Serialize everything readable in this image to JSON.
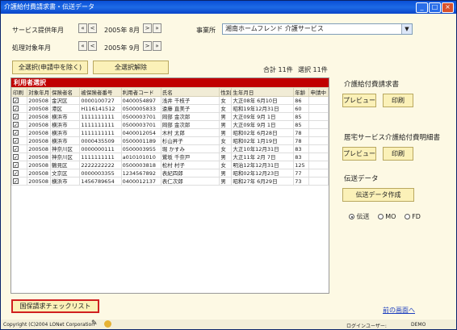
{
  "window": {
    "title": "介護給付費請求書・伝送データ"
  },
  "header": {
    "service_label": "サービス提供年月",
    "service_value": "2005年 8月",
    "process_label": "処理対象年月",
    "process_value": "2005年 9月",
    "office_label": "事業所",
    "office_value": "湘南ホームフレンド 介護サービス"
  },
  "buttons": {
    "select_all": "全選択(申請中を除く)",
    "deselect_all": "全選択解除",
    "preview1": "プレビュー",
    "print1": "印刷",
    "preview2": "プレビュー",
    "print2": "印刷",
    "create_transfer": "伝送データ作成",
    "checklist": "国保請求チェックリスト"
  },
  "totals": {
    "total": "合計 11件",
    "selected": "選択 11件"
  },
  "list": {
    "title": "利用者選択",
    "columns": [
      "印刷",
      "対象年月",
      "保険者名",
      "被保険者番号",
      "利用者コード",
      "氏名",
      "性別",
      "生年月日",
      "年齢",
      "申請中"
    ],
    "rows": [
      [
        "200508",
        "金沢区",
        "0000100727",
        "0400054897",
        "浅井 千枝子",
        "女",
        "大正08年 6月10日",
        "86",
        ""
      ],
      [
        "200508",
        "港区",
        "H116141512",
        "0500005833",
        "遠藤 直美子",
        "女",
        "昭和19年12月31日",
        "60",
        ""
      ],
      [
        "200508",
        "横浜市",
        "1111111111",
        "0500003701",
        "岡部 金次郎",
        "男",
        "大正09年 9月 1日",
        "85",
        ""
      ],
      [
        "200508",
        "横浜市",
        "1111111111",
        "0500003701",
        "岡部 金次郎",
        "男",
        "大正09年 9月 1日",
        "85",
        ""
      ],
      [
        "200508",
        "横浜市",
        "1111111111",
        "0400012054",
        "木村 太郎",
        "男",
        "昭和02年 6月28日",
        "78",
        ""
      ],
      [
        "200508",
        "横浜市",
        "0000435509",
        "0500001189",
        "杉山昇子",
        "女",
        "昭和02年 1月19日",
        "78",
        ""
      ],
      [
        "200508",
        "神奈川区",
        "0000000111",
        "0500003955",
        "堀 かすみ",
        "女",
        "大正10年12月31日",
        "83",
        ""
      ],
      [
        "200508",
        "神奈川区",
        "1111111111",
        "a010101010",
        "鷺坂 千奈戸",
        "男",
        "大正11年 2月 7日",
        "83",
        ""
      ],
      [
        "200508",
        "鶴見区",
        "2222222222",
        "0500003818",
        "松村 村子",
        "女",
        "明治12年12月31日",
        "125",
        ""
      ],
      [
        "200508",
        "文京区",
        "0000003355",
        "1234567892",
        "表紀四郎",
        "男",
        "昭和02年12月23日",
        "77",
        ""
      ],
      [
        "200508",
        "横浜市",
        "1456789654",
        "0400012137",
        "表仁次郎",
        "男",
        "昭和27年 6月29日",
        "73",
        ""
      ]
    ]
  },
  "right": {
    "care_invoice_title": "介護給付費請求書",
    "home_service_title": "居宅サービス介護給付費明細書",
    "transfer_title": "伝送データ",
    "radio_options": [
      "伝送",
      "MO",
      "FD"
    ],
    "radio_selected": "伝送"
  },
  "footer": {
    "copyright": "Copyright (C)2004 LONet Corporation",
    "login_label": "ログインユーザー:",
    "login_user": "DEMO",
    "back_link": "前の画面へ"
  },
  "icons": [
    "minimize-icon",
    "maximize-icon",
    "close-icon",
    "first-icon",
    "prev-icon",
    "next-icon",
    "last-icon",
    "dropdown-arrow-icon",
    "pencil-icon",
    "coin-icon"
  ]
}
